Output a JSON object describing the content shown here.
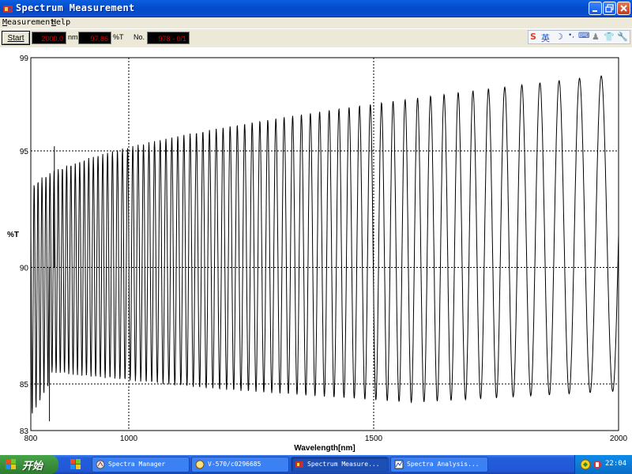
{
  "window": {
    "title": "Spectrum Measurement",
    "buttons": [
      "minimize",
      "maximize",
      "close"
    ]
  },
  "menu": {
    "items": [
      {
        "label": "Measurement",
        "accel": "M"
      },
      {
        "label": "Help",
        "accel": "H"
      }
    ]
  },
  "toolbar": {
    "start_label": "Start",
    "wavelength_value": "2000.0",
    "wavelength_unit": "nm",
    "transmittance_value": "97.86",
    "transmittance_unit": "%T",
    "number_label": "No.",
    "number_value": "978 - 0/1"
  },
  "ime_bar": {
    "icons": [
      "sogou-s-icon",
      "chinese-english-icon",
      "moon-icon",
      "punctuation-icon",
      "keyboard-icon",
      "user-icon",
      "shirt-icon",
      "wrench-icon"
    ],
    "lang_label": "英"
  },
  "chart_data": {
    "type": "line",
    "xlabel": "Wavelength[nm]",
    "ylabel": "%T",
    "xlim": [
      800,
      2000
    ],
    "ylim": [
      83,
      99
    ],
    "x_ticks": [
      800,
      1000,
      1500,
      2000
    ],
    "y_ticks": [
      83,
      85,
      90,
      95,
      99
    ],
    "grid": true,
    "grid_x": [
      1000,
      1500
    ],
    "grid_y": [
      85,
      90,
      95
    ],
    "series": [
      {
        "color": "#000000",
        "description_points": {
          "x_start": 800,
          "x_end": 2000,
          "period_nm_at_800": 7.8,
          "period_nm_at_2000": 48.5,
          "peak_start": 93.3,
          "peak_end": 98.3,
          "trough_start": 84.2,
          "trough_end": 84.7,
          "trough_mid": 84.2
        },
        "noise_spikes": [
          {
            "x": 848,
            "y": 95.2
          },
          {
            "x": 838,
            "y": 83.4
          }
        ]
      }
    ]
  },
  "taskbar": {
    "start_label": "开始",
    "tasks": [
      {
        "label": "Spectra Manager",
        "icon": "spectra-manager-icon",
        "active": false
      },
      {
        "label": "V-570/c0296685",
        "icon": "instrument-icon",
        "active": false
      },
      {
        "label": "Spectrum Measure...",
        "icon": "spectrum-measure-icon",
        "active": true
      },
      {
        "label": "Spectra Analysis...",
        "icon": "spectra-analysis-icon",
        "active": false
      }
    ],
    "tray_icons": [
      "network-icon",
      "volume-icon"
    ],
    "clock": "22:04"
  }
}
